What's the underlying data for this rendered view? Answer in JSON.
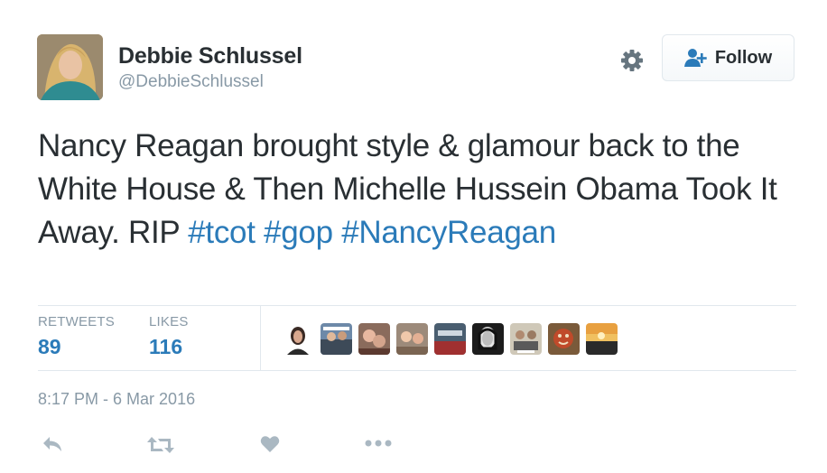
{
  "author": {
    "name": "Debbie Schlussel",
    "handle": "@DebbieSchlussel"
  },
  "follow_button": {
    "label": "Follow"
  },
  "tweet": {
    "text_plain": "Nancy Reagan brought style & glamour back to the White House & Then Michelle Hussein Obama Took It Away. RIP ",
    "hashtags": [
      "#tcot",
      "#gop",
      "#NancyReagan"
    ]
  },
  "stats": {
    "retweets_label": "RETWEETS",
    "retweets_count": "89",
    "likes_label": "LIKES",
    "likes_count": "116"
  },
  "likers": [
    {
      "icon": "liker-avatar"
    },
    {
      "icon": "liker-avatar"
    },
    {
      "icon": "liker-avatar"
    },
    {
      "icon": "liker-avatar"
    },
    {
      "icon": "liker-avatar"
    },
    {
      "icon": "liker-avatar"
    },
    {
      "icon": "liker-avatar"
    },
    {
      "icon": "liker-avatar"
    },
    {
      "icon": "liker-avatar"
    }
  ],
  "timestamp": "8:17 PM - 6 Mar 2016",
  "actions": [
    "reply-icon",
    "retweet-icon",
    "like-icon",
    "more-icon"
  ],
  "colors": {
    "link": "#2b7bb9",
    "muted": "#8899a6",
    "text": "#292f33",
    "icon": "#aab8c2",
    "follow_icon": "#2b7bb9"
  }
}
